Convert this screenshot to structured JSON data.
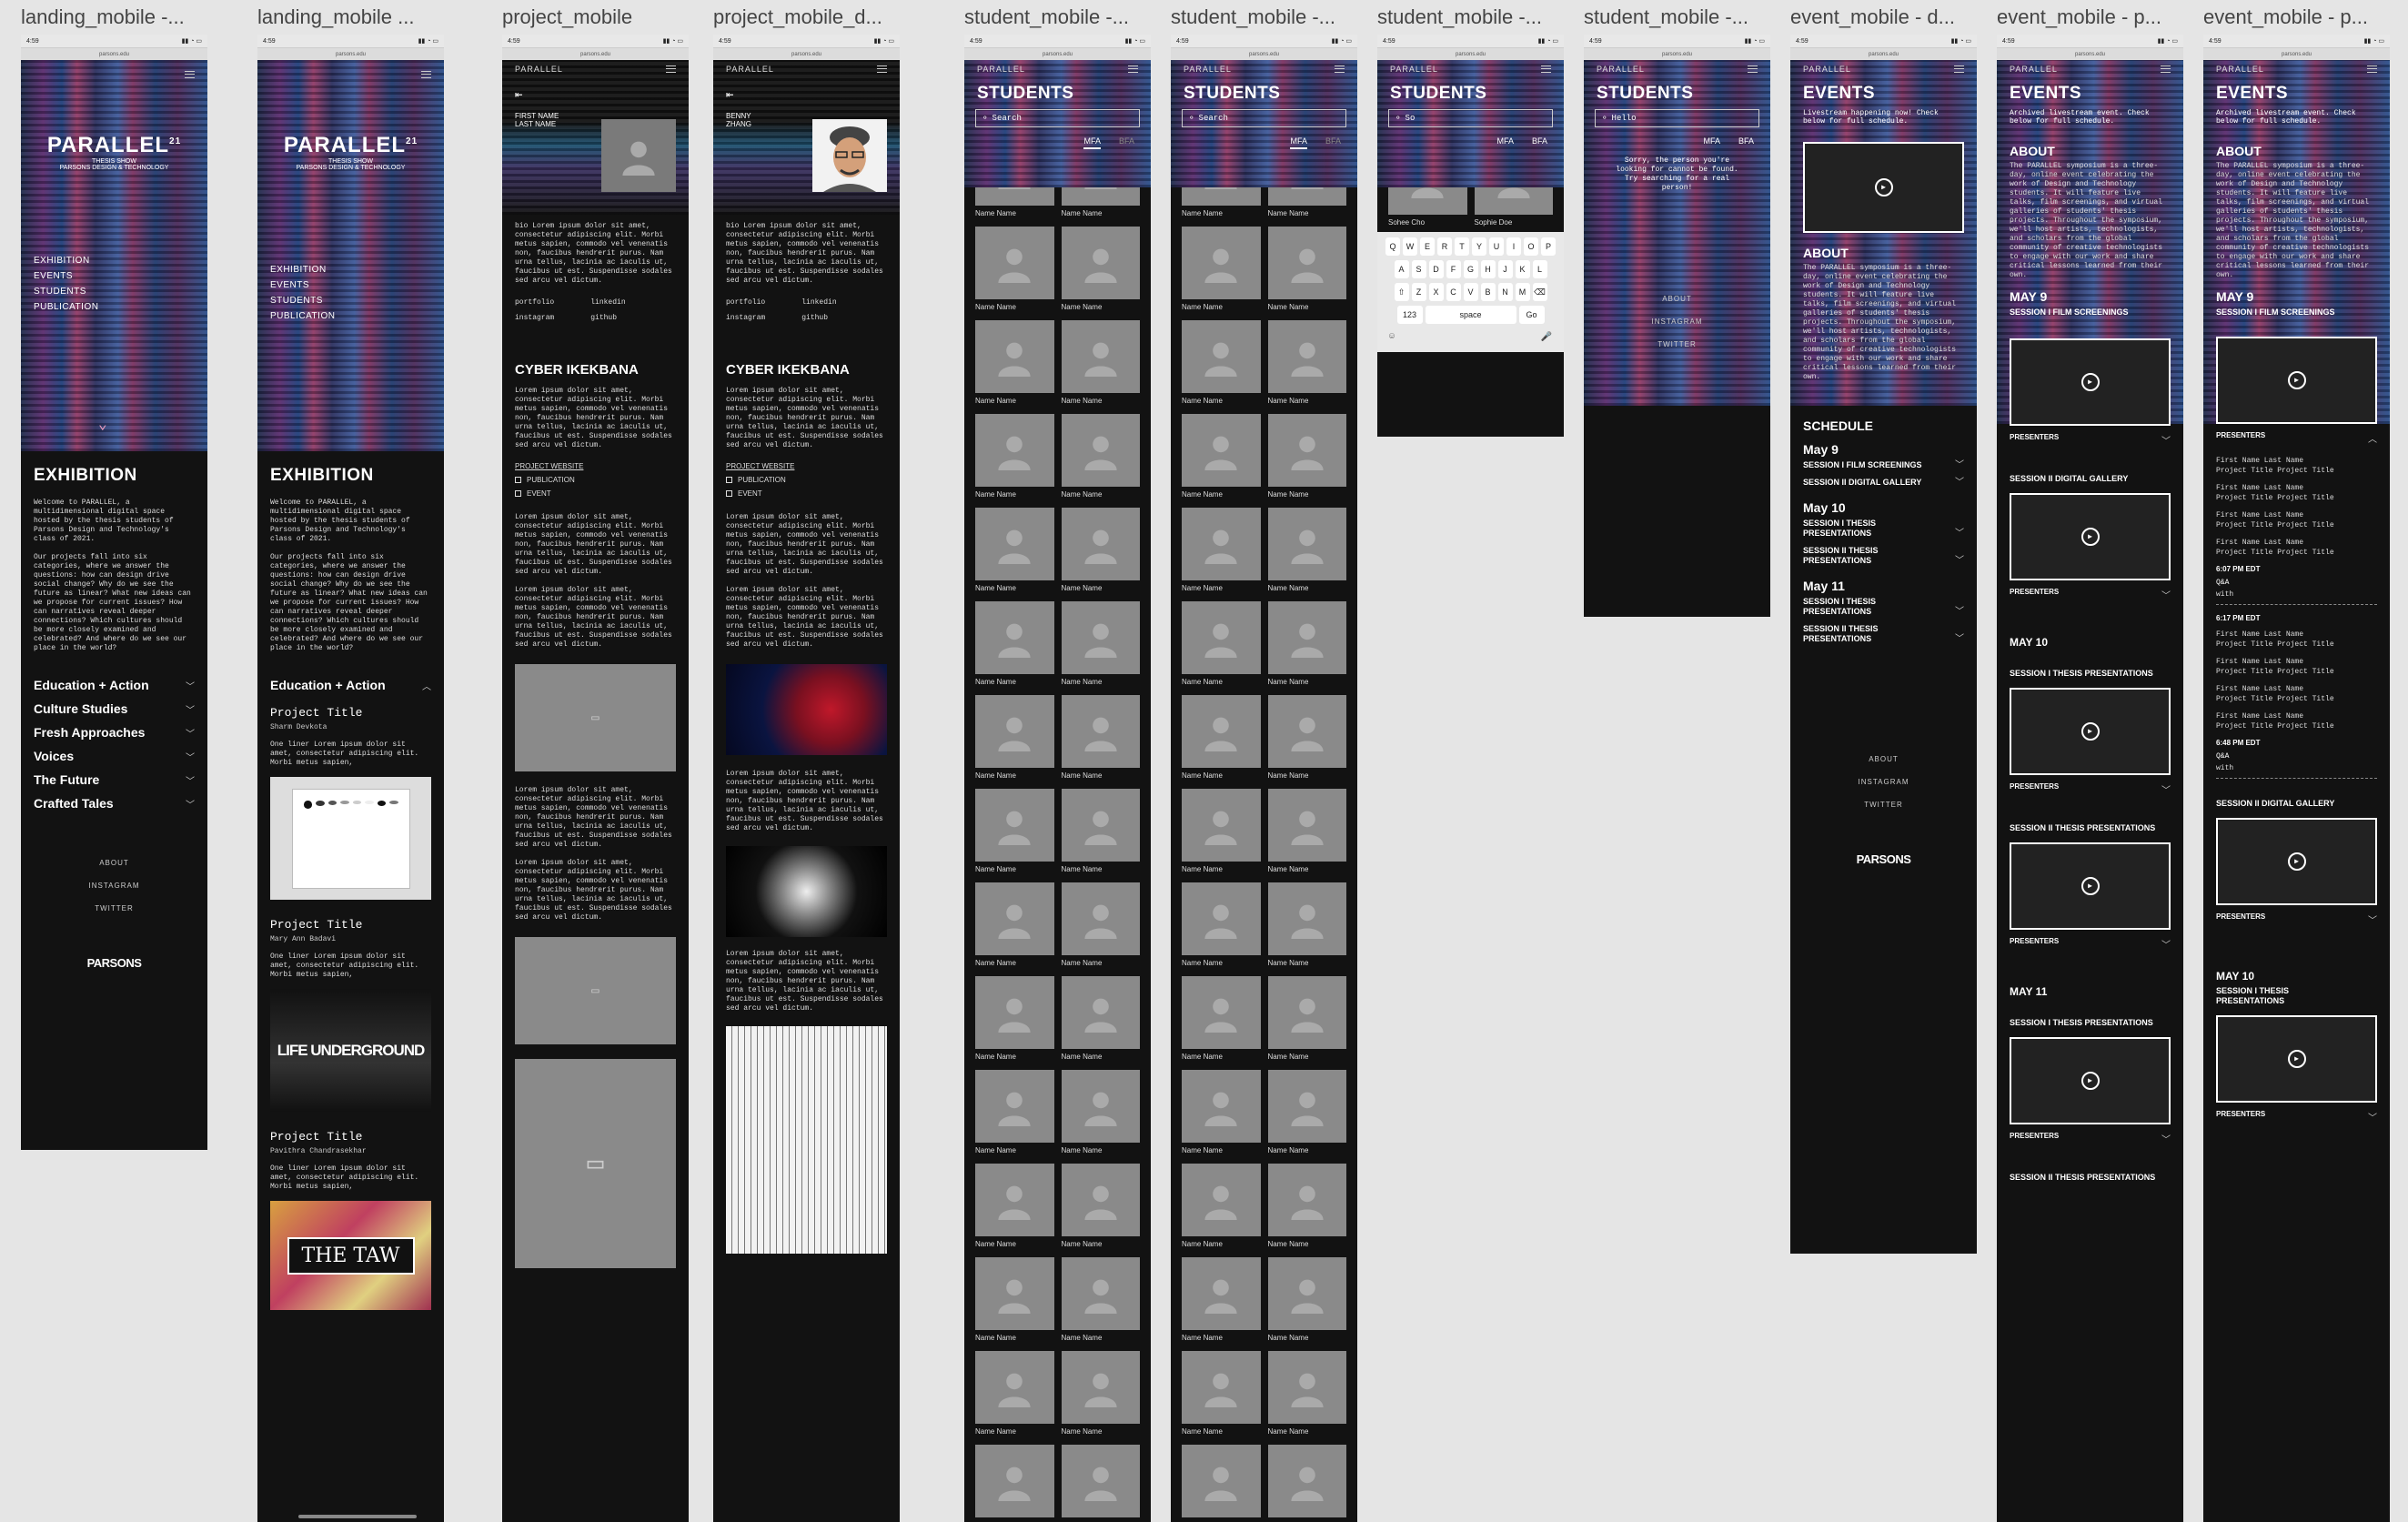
{
  "labels": {
    "f1": "landing_mobile -...",
    "f2": "landing_mobile ...",
    "f3": "project_mobile",
    "f4": "project_mobile_d...",
    "f5": "student_mobile -...",
    "f6": "student_mobile -...",
    "f7": "student_mobile -...",
    "f8": "student_mobile -...",
    "f9": "event_mobile - d...",
    "f10": "event_mobile - p...",
    "f11": "event_mobile - p..."
  },
  "status": {
    "time": "4:59",
    "url": "parsons.edu"
  },
  "nav": {
    "brand": "PARALLEL"
  },
  "landing": {
    "title": "PARALLEL",
    "title_sup": "21",
    "sub1": "THESIS SHOW",
    "sub2": "PARSONS DESIGN & TECHNOLOGY",
    "menu": [
      "EXHIBITION",
      "EVENTS",
      "STUDENTS",
      "PUBLICATION"
    ],
    "section_title": "EXHIBITION",
    "intro1": "Welcome to PARALLEL, a multidimensional digital space hosted by the thesis students of Parsons Design and Technology's class of 2021.",
    "intro2": "Our projects fall into six categories, where we answer the questions: how can design drive social change? Why do we see the future as linear? What new ideas can we propose for current issues? How can narratives reveal deeper connections? Which cultures should be more closely examined and celebrated? And where do we see our place in the world?",
    "categories": [
      "Education + Action",
      "Culture Studies",
      "Fresh Approaches",
      "Voices",
      "The Future",
      "Crafted Tales"
    ],
    "footer": [
      "ABOUT",
      "INSTAGRAM",
      "TWITTER"
    ],
    "logo": "PARSONS"
  },
  "landing2": {
    "expanded": "Education + Action",
    "projects": [
      {
        "title": "Project Title",
        "author": "Sharm Devkota",
        "desc": "One liner Lorem ipsum dolor sit amet, consectetur adipiscing elit. Morbi metus sapien,"
      },
      {
        "title": "Project Title",
        "author": "Mary Ann Badavi",
        "desc": "One liner Lorem ipsum dolor sit amet, consectetur adipiscing elit. Morbi metus sapien,"
      },
      {
        "title": "Project Title",
        "author": "Pavithra Chandrasekhar",
        "desc": "One liner Lorem ipsum dolor sit amet, consectetur adipiscing elit. Morbi metus sapien,"
      }
    ],
    "img2_text": "LIFE UNDERGROUND",
    "img3_text": "THE TAW"
  },
  "project": {
    "name_placeholder": "FIRST NAME LAST NAME",
    "name_real": "BENNY ZHANG",
    "bio": "bio Lorem ipsum dolor sit amet, consectetur adipiscing elit. Morbi metus sapien, commodo vel venenatis non, faucibus hendrerit purus. Nam urna tellus, lacinia ac iaculis ut, faucibus ut est. Suspendisse sodales sed arcu vel dictum.",
    "links": [
      "portfolio",
      "linkedin",
      "instagram",
      "github"
    ],
    "title": "CYBER IKEKBANA",
    "body": "Lorem ipsum dolor sit amet, consectetur adipiscing elit. Morbi metus sapien, commodo vel venenatis non, faucibus hendrerit purus. Nam urna tellus, lacinia ac iaculis ut, faucibus ut est. Suspendisse sodales sed arcu vel dictum.",
    "website_label": "PROJECT WEBSITE",
    "publication": "PUBLICATION",
    "event": "EVENT"
  },
  "students": {
    "title": "STUDENTS",
    "search_placeholder": "Search",
    "search_typed1": "So",
    "search_typed2": "Hello",
    "tab_mfa": "MFA",
    "tab_bfa": "BFA",
    "card_name": "Name Name",
    "found": [
      "Sohee Cho",
      "Sophie Doe"
    ],
    "not_found": "Sorry, the person you're looking for cannot be found. Try searching for a real person!",
    "kb_row1": [
      "Q",
      "W",
      "E",
      "R",
      "T",
      "Y",
      "U",
      "I",
      "O",
      "P"
    ],
    "kb_row2": [
      "A",
      "S",
      "D",
      "F",
      "G",
      "H",
      "J",
      "K",
      "L"
    ],
    "kb_row3": [
      "Z",
      "X",
      "C",
      "V",
      "B",
      "N",
      "M"
    ],
    "kb_123": "123",
    "kb_space": "space",
    "kb_go": "Go"
  },
  "events": {
    "title": "EVENTS",
    "live_note": "Livestream happening now! Check below for full schedule.",
    "archived_note": "Archived livestream event. Check below for full schedule.",
    "about_title": "ABOUT",
    "about_text": "The PARALLEL symposium is a three-day, online event celebrating the work of Design and Technology students. It will feature live talks, film screenings, and virtual galleries of students' thesis projects. Throughout the symposium, we'll host artists, technologists, and scholars from the global community of creative technologists to engage with our work and share critical lessons learned from their own.",
    "schedule_title": "SCHEDULE",
    "days": [
      {
        "day": "May 9",
        "sessions": [
          "SESSION I FILM SCREENINGS",
          "SESSION II DIGITAL GALLERY"
        ]
      },
      {
        "day": "May 10",
        "sessions": [
          "SESSION I THESIS PRESENTATIONS",
          "SESSION II THESIS PRESENTATIONS"
        ]
      },
      {
        "day": "May 11",
        "sessions": [
          "SESSION I THESIS PRESENTATIONS",
          "SESSION II THESIS PRESENTATIONS"
        ]
      }
    ],
    "day_caps": [
      "MAY 9",
      "MAY 10",
      "MAY 11"
    ],
    "s_film": "SESSION I FILM SCREENINGS",
    "s_dg": "SESSION II DIGITAL GALLERY",
    "s_tp1": "SESSION I THESIS PRESENTATIONS",
    "s_tp2": "SESSION II THESIS PRESENTATIONS",
    "presenters": "PRESENTERS",
    "presenter_line1": "First Name Last Name",
    "presenter_line2": "Project Title Project Title",
    "time1": "6:07 PM EDT",
    "time2": "6:17 PM EDT",
    "time3": "6:48 PM EDT",
    "qa": "Q&A",
    "with": "with"
  }
}
